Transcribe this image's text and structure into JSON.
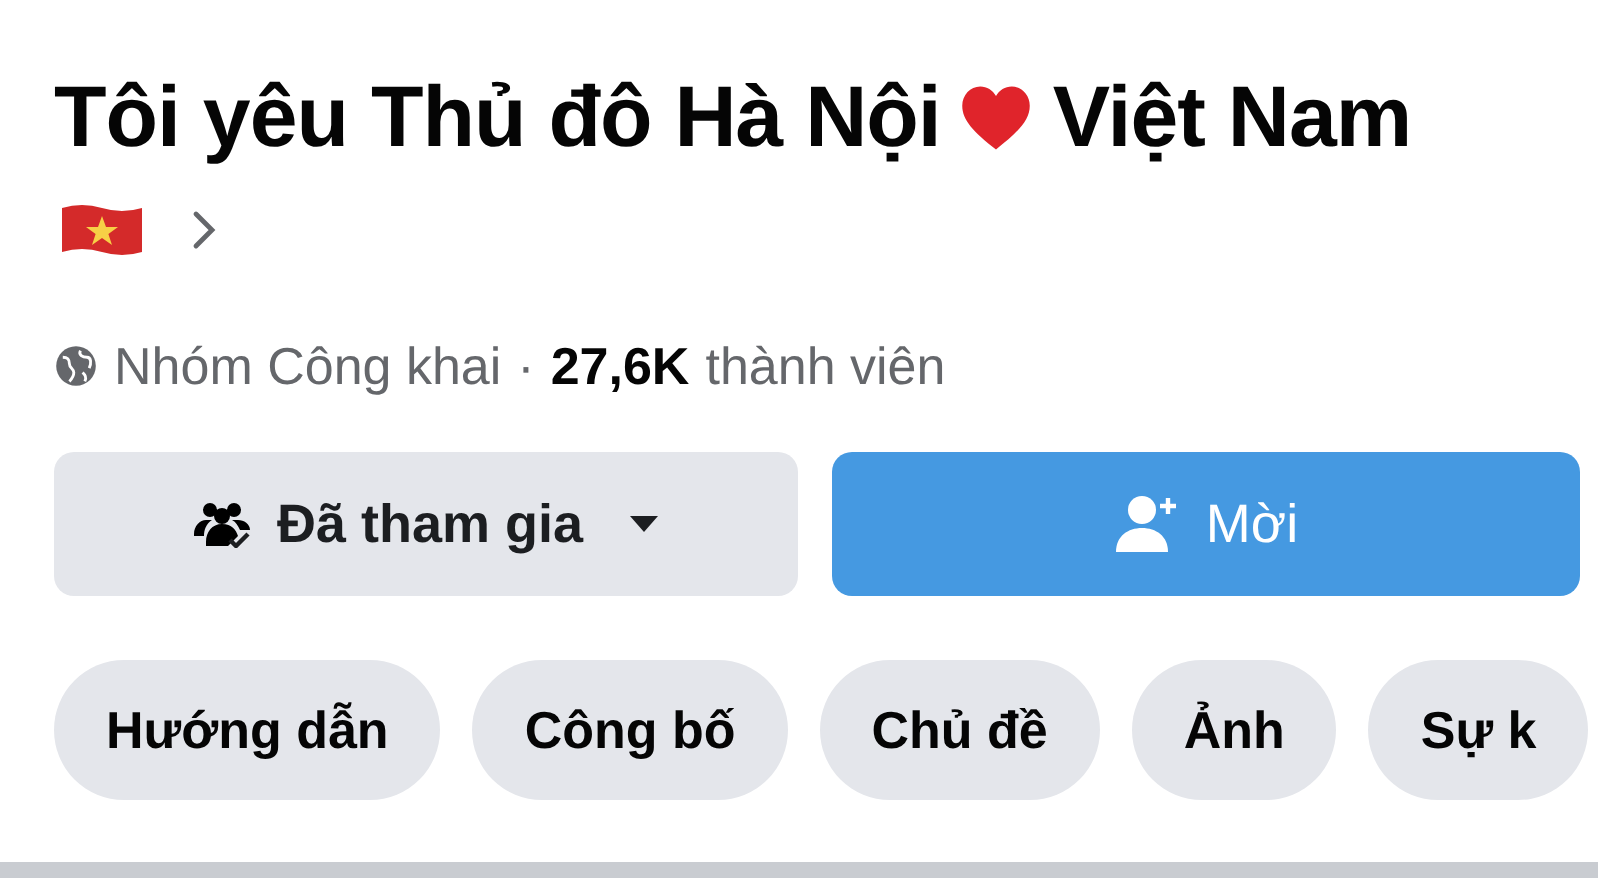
{
  "group": {
    "title_parts": [
      "Tôi yêu Thủ đô Hà Nội",
      "Việt Nam"
    ],
    "privacy": "Nhóm Công khai",
    "separator": "·",
    "member_count": "27,6K",
    "member_label": "thành viên"
  },
  "buttons": [
    {
      "kind": "joined",
      "label": "Đã tham gia"
    },
    {
      "kind": "invite",
      "label": "Mời"
    }
  ],
  "chips": [
    {
      "label": "Hướng dẫn"
    },
    {
      "label": "Công bố"
    },
    {
      "label": "Chủ đề"
    },
    {
      "label": "Ảnh"
    },
    {
      "label": "Sự k"
    }
  ]
}
